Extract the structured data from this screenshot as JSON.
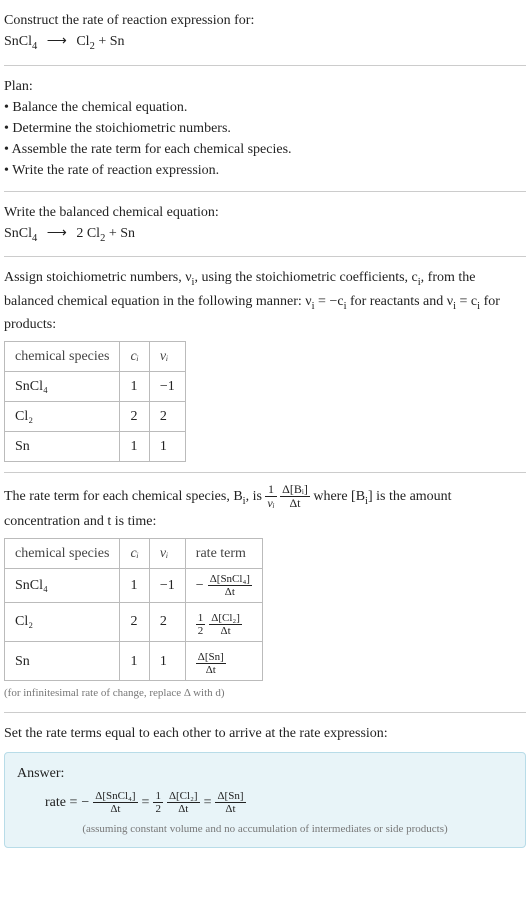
{
  "header": {
    "prompt": "Construct the rate of reaction expression for:",
    "unbalanced_left": "SnCl",
    "unbalanced_left_sub": "4",
    "arrow": "⟶",
    "unbalanced_right_1": "Cl",
    "unbalanced_right_1_sub": "2",
    "plus": " + ",
    "unbalanced_right_2": "Sn"
  },
  "plan": {
    "title": "Plan:",
    "items": [
      "Balance the chemical equation.",
      "Determine the stoichiometric numbers.",
      "Assemble the rate term for each chemical species.",
      "Write the rate of reaction expression."
    ]
  },
  "balanced": {
    "title": "Write the balanced chemical equation:",
    "left": "SnCl",
    "left_sub": "4",
    "arrow": "⟶",
    "coef": "2",
    "right_1": "Cl",
    "right_1_sub": "2",
    "plus": " + ",
    "right_2": "Sn"
  },
  "stoich": {
    "intro_1": "Assign stoichiometric numbers, ν",
    "intro_1_sub": "i",
    "intro_2": ", using the stoichiometric coefficients, c",
    "intro_2_sub": "i",
    "intro_3": ", from the balanced chemical equation in the following manner: ν",
    "intro_3_sub": "i",
    "intro_4": " = −c",
    "intro_4_sub": "i",
    "intro_5": " for reactants and ν",
    "intro_5_sub": "i",
    "intro_6": " = c",
    "intro_6_sub": "i",
    "intro_7": " for products:",
    "headers": {
      "species": "chemical species",
      "c": "cᵢ",
      "nu": "νᵢ"
    },
    "rows": [
      {
        "species": "SnCl₄",
        "c": "1",
        "nu": "−1"
      },
      {
        "species": "Cl₂",
        "c": "2",
        "nu": "2"
      },
      {
        "species": "Sn",
        "c": "1",
        "nu": "1"
      }
    ]
  },
  "rateterm": {
    "intro_1": "The rate term for each chemical species, B",
    "intro_1_sub": "i",
    "intro_2": ", is ",
    "frac1_num": "1",
    "frac1_den": "νᵢ",
    "frac2_num": "Δ[Bᵢ]",
    "frac2_den": "Δt",
    "intro_3": " where [B",
    "intro_3_sub": "i",
    "intro_4": "] is the amount concentration and t is time:",
    "headers": {
      "species": "chemical species",
      "c": "cᵢ",
      "nu": "νᵢ",
      "rate": "rate term"
    },
    "rows": [
      {
        "species": "SnCl₄",
        "c": "1",
        "nu": "−1",
        "sign": "−",
        "num1": "",
        "den1": "",
        "num2": "Δ[SnCl₄]",
        "den2": "Δt"
      },
      {
        "species": "Cl₂",
        "c": "2",
        "nu": "2",
        "sign": "",
        "num1": "1",
        "den1": "2",
        "num2": "Δ[Cl₂]",
        "den2": "Δt"
      },
      {
        "species": "Sn",
        "c": "1",
        "nu": "1",
        "sign": "",
        "num1": "",
        "den1": "",
        "num2": "Δ[Sn]",
        "den2": "Δt"
      }
    ],
    "note": "(for infinitesimal rate of change, replace Δ with d)"
  },
  "final": {
    "intro": "Set the rate terms equal to each other to arrive at the rate expression:",
    "answer_label": "Answer:",
    "rate_label": "rate = ",
    "neg": "−",
    "t1_num": "Δ[SnCl₄]",
    "t1_den": "Δt",
    "eq": " = ",
    "half_num": "1",
    "half_den": "2",
    "t2_num": "Δ[Cl₂]",
    "t2_den": "Δt",
    "t3_num": "Δ[Sn]",
    "t3_den": "Δt",
    "note": "(assuming constant volume and no accumulation of intermediates or side products)"
  }
}
